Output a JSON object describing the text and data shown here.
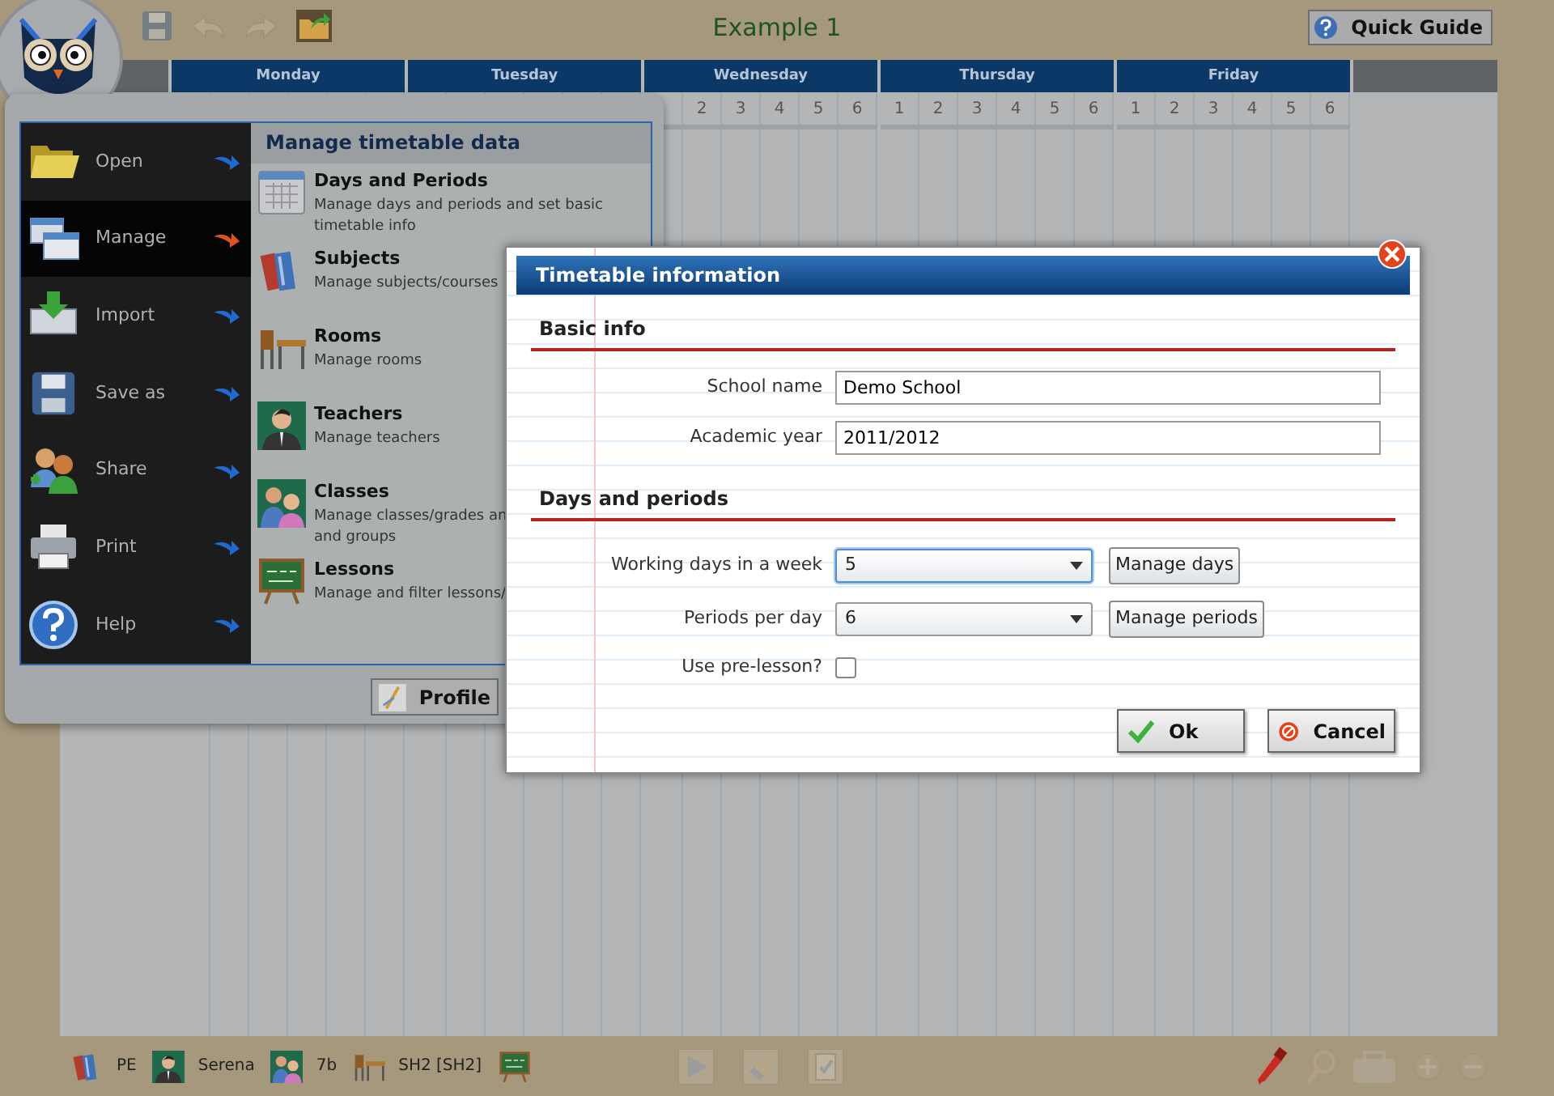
{
  "toolbar": {
    "buttons": [
      {
        "kind": "save",
        "disabled": true
      },
      {
        "kind": "undo",
        "disabled": true
      },
      {
        "kind": "redo",
        "disabled": true
      },
      {
        "kind": "export",
        "disabled": false
      }
    ],
    "title": "Example 1",
    "guide_button": "Quick Guide"
  },
  "timetable": {
    "days": [
      {
        "name": "Monday"
      },
      {
        "name": "Tuesday"
      },
      {
        "name": "Wednesday",
        "periods": [
          "2",
          "3",
          "4",
          "5",
          "6"
        ]
      },
      {
        "name": "Thursday",
        "periods": [
          "1",
          "2",
          "3",
          "4",
          "5",
          "6"
        ]
      },
      {
        "name": "Friday",
        "periods": [
          "1",
          "2",
          "3",
          "4",
          "5",
          "6"
        ]
      }
    ]
  },
  "menu": {
    "items": [
      {
        "kind": "open",
        "label": "Open",
        "selected": false
      },
      {
        "kind": "manage",
        "label": "Manage",
        "selected": true
      },
      {
        "kind": "import",
        "label": "Import",
        "selected": false
      },
      {
        "kind": "save",
        "label": "Save as",
        "selected": false
      },
      {
        "kind": "share",
        "label": "Share",
        "selected": false
      },
      {
        "kind": "print",
        "label": "Print",
        "selected": false
      },
      {
        "kind": "help",
        "label": "Help",
        "selected": false
      }
    ],
    "section_title": "Manage timetable data",
    "entries": [
      {
        "kind": "calendar",
        "title": "Days and Periods",
        "description": "Manage days and periods and set basic\ntimetable info"
      },
      {
        "kind": "books",
        "title": "Subjects",
        "description": "Manage subjects/courses"
      },
      {
        "kind": "desk",
        "title": "Rooms",
        "description": "Manage rooms"
      },
      {
        "kind": "teacher",
        "title": "Teachers",
        "description": "Manage teachers"
      },
      {
        "kind": "group",
        "title": "Classes",
        "description": "Manage classes/grades an\nand groups"
      },
      {
        "kind": "board",
        "title": "Lessons",
        "description": "Manage and filter lessons/"
      }
    ],
    "profile_button": "Profile"
  },
  "dialog": {
    "title": "Timetable information",
    "sections": [
      {
        "title": "Basic info",
        "fields": [
          {
            "kind": "text",
            "label": "School name",
            "value": "Demo School"
          },
          {
            "kind": "text",
            "label": "Academic year",
            "value": "2011/2012"
          }
        ]
      },
      {
        "title": "Days and periods",
        "fields": [
          {
            "kind": "select",
            "label": "Working days in a week",
            "value": "5",
            "focused": true,
            "button": "Manage days"
          },
          {
            "kind": "select",
            "label": "Periods per day",
            "value": "6",
            "focused": false,
            "button": "Manage periods"
          },
          {
            "kind": "checkbox",
            "label": "Use pre-lesson?",
            "checked": false
          }
        ]
      }
    ],
    "buttons": [
      {
        "kind": "ok",
        "label": "Ok"
      },
      {
        "kind": "cancel",
        "label": "Cancel"
      }
    ]
  },
  "bottom_bar": {
    "items": [
      {
        "kind": "books",
        "label": "PE"
      },
      {
        "kind": "teacher",
        "label": "Serena"
      },
      {
        "kind": "group",
        "label": "7b"
      },
      {
        "kind": "desk",
        "label": "SH2 [SH2]"
      },
      {
        "kind": "board"
      }
    ],
    "tools": [
      {
        "kind": "play",
        "disabled": true
      },
      {
        "kind": "eraser",
        "disabled": true
      },
      {
        "kind": "clipboard",
        "disabled": true
      }
    ],
    "view_tools": [
      {
        "kind": "marker",
        "disabled": false
      },
      {
        "kind": "magnifier",
        "disabled": true
      },
      {
        "kind": "toolbox",
        "disabled": true
      },
      {
        "kind": "zoom-in",
        "disabled": true
      },
      {
        "kind": "zoom-out",
        "disabled": true
      }
    ]
  }
}
